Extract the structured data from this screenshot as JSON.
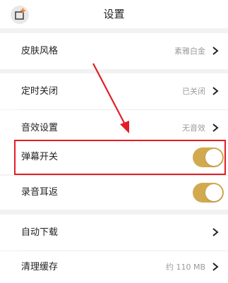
{
  "header": {
    "title": "设置"
  },
  "settings": {
    "skin": {
      "label": "皮肤风格",
      "value": "素雅白金"
    },
    "sleep_timer": {
      "label": "定时关闭",
      "value": "已关闭"
    },
    "sound_effect": {
      "label": "音效设置",
      "value": "无音效"
    },
    "danmaku": {
      "label": "弹幕开关",
      "enabled": true
    },
    "ear_return": {
      "label": "录音耳返",
      "enabled": true
    },
    "auto_download": {
      "label": "自动下载"
    },
    "clear_cache": {
      "label": "清理缓存",
      "value": "约 110 MB"
    }
  },
  "colors": {
    "toggle_on": "#d2a94f",
    "annotation": "#e21d25",
    "back_icon_accent": "#f5822a"
  },
  "icons": {
    "back": "back-icon",
    "chevron": "chevron-right-icon"
  }
}
